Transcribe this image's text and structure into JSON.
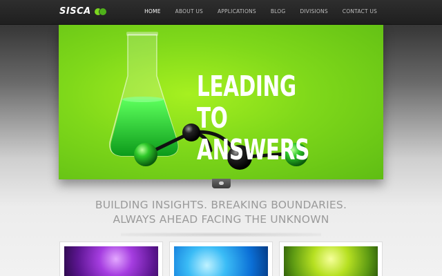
{
  "brand": {
    "logo_text": "SISCA"
  },
  "nav": {
    "items": [
      {
        "label": "HOME",
        "active": true
      },
      {
        "label": "ABOUT US"
      },
      {
        "label": "APPLICATIONS"
      },
      {
        "label": "BLOG"
      },
      {
        "label": "DIVISIONS"
      },
      {
        "label": "CONTACT US"
      }
    ]
  },
  "hero": {
    "title_line1": "LEADING TO",
    "title_line2": "ANSWERS"
  },
  "tagline": {
    "line1": "BUILDING INSIGHTS. BREAKING BOUNDARIES.",
    "line2": "ALWAYS AHEAD FACING THE UNKNOWN"
  },
  "colors": {
    "accent_green": "#7bd61f",
    "header_bg": "#222222",
    "tagline_text": "#9a9a9a"
  },
  "thumbnails": [
    {
      "icon": "purple-lab-equipment-image"
    },
    {
      "icon": "blue-molecular-structure-image"
    },
    {
      "icon": "green-leaves-image"
    }
  ]
}
